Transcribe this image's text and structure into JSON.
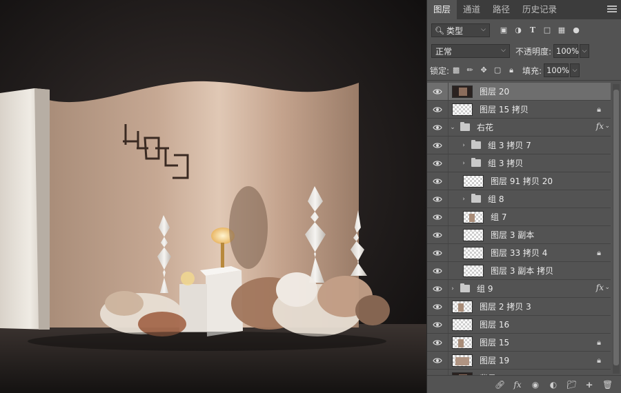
{
  "panel": {
    "tabs": [
      {
        "label": "图层",
        "active": true
      },
      {
        "label": "通道",
        "active": false
      },
      {
        "label": "路径",
        "active": false
      },
      {
        "label": "历史记录",
        "active": false
      }
    ],
    "filter_label": "类型",
    "blend_mode": "正常",
    "opacity_label": "不透明度:",
    "opacity_value": "100%",
    "lock_label": "锁定:",
    "fill_label": "填充:",
    "fill_value": "100%",
    "layers": [
      {
        "name": "图层 20",
        "thumb": "dark",
        "selected": true
      },
      {
        "name": "图层 15 拷贝",
        "thumb": "checker",
        "locked": true
      },
      {
        "name": "右花",
        "type": "group",
        "expanded": true,
        "fx": true
      },
      {
        "name": "组 3 拷贝 7",
        "type": "group",
        "indent": 1
      },
      {
        "name": "组 3 拷贝",
        "type": "group",
        "indent": 1
      },
      {
        "name": "图层 91 拷贝 20",
        "thumb": "checker",
        "indent": 1
      },
      {
        "name": "组 8",
        "type": "group",
        "indent": 1
      },
      {
        "name": "组 7",
        "thumb": "obj",
        "indent": 1
      },
      {
        "name": "图层 3 副本",
        "thumb": "checker",
        "indent": 1
      },
      {
        "name": "图层 33 拷贝 4",
        "thumb": "checker",
        "indent": 1,
        "locked": true
      },
      {
        "name": "图层 3 副本 拷贝",
        "thumb": "checker",
        "indent": 1
      },
      {
        "name": "组 9",
        "type": "group",
        "fx": true
      },
      {
        "name": "图层 2 拷贝 3",
        "thumb": "obj"
      },
      {
        "name": "图层 16",
        "thumb": "checker"
      },
      {
        "name": "图层 15",
        "thumb": "obj",
        "locked": true
      },
      {
        "name": "图层 19",
        "thumb": "obj2",
        "locked": true
      },
      {
        "name": "背景",
        "thumb": "dark"
      }
    ]
  },
  "colors": {
    "panel_bg": "#535353",
    "selected_row": "#6e6e6e",
    "backdrop": "#c4a48e"
  },
  "icons": [
    "search-icon",
    "image-filter-icon",
    "adjustment-filter-icon",
    "text-filter-icon",
    "shape-filter-icon",
    "smart-object-filter-icon",
    "eye-icon",
    "lock-icon",
    "link-icon",
    "fx-icon",
    "mask-icon",
    "adjustment-icon",
    "folder-icon",
    "new-layer-icon",
    "trash-icon",
    "menu-icon"
  ]
}
